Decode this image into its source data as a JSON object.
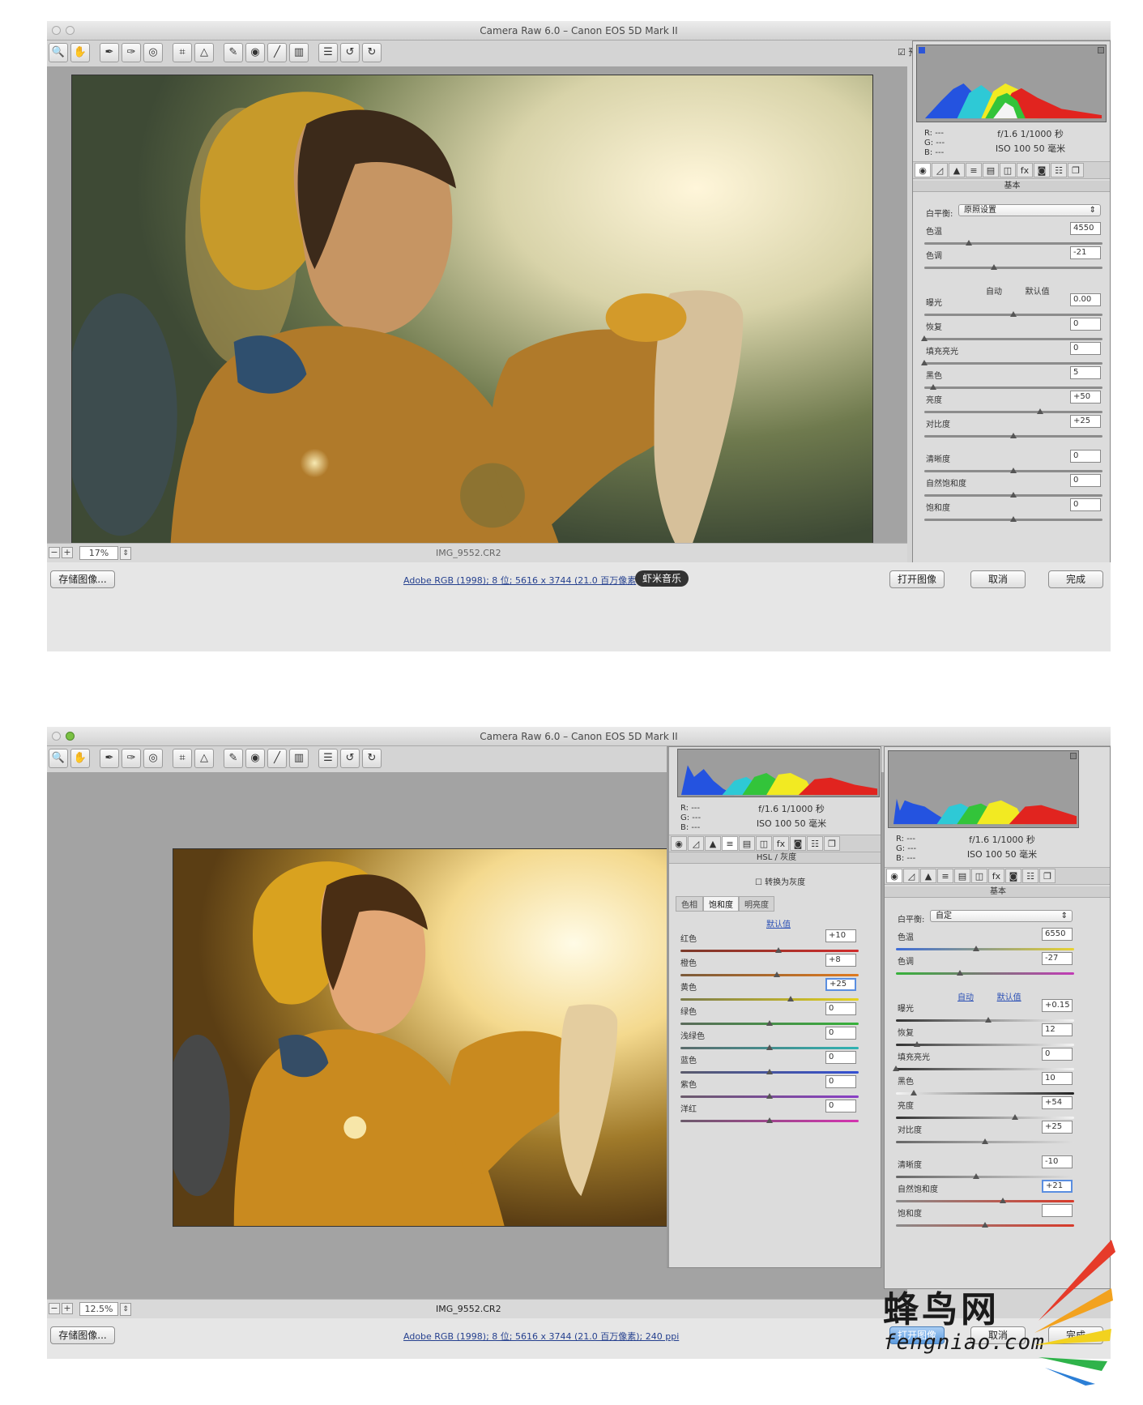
{
  "top": {
    "title": "Camera Raw 6.0 –  Canon EOS 5D Mark II",
    "preview_label": "预览",
    "zoom": "17%",
    "filename": "IMG_9552.CR2",
    "save_label": "存储图像...",
    "info_link": "Adobe RGB (1998); 8 位;   5616 x 3744 (21.0 百万像素",
    "tooltip": "虾米音乐",
    "open_label": "打开图像",
    "cancel_label": "取消",
    "done_label": "完成",
    "rgb": [
      "R:  ---",
      "G:  ---",
      "B:  ---"
    ],
    "exif_line1": "f/1.6    1/1000 秒",
    "exif_line2": "ISO 100    50 毫米",
    "section": "基本",
    "wb_label": "白平衡:",
    "wb_value": "原照设置",
    "auto_label": "自动",
    "default_label": "默认值",
    "sliders": [
      {
        "label": "色温",
        "value": "4550",
        "pos": 0.25
      },
      {
        "label": "色调",
        "value": "-21",
        "pos": 0.39
      },
      {
        "label": "曝光",
        "value": "0.00",
        "pos": 0.5
      },
      {
        "label": "恢复",
        "value": "0",
        "pos": 0.0
      },
      {
        "label": "填充亮光",
        "value": "0",
        "pos": 0.0
      },
      {
        "label": "黑色",
        "value": "5",
        "pos": 0.05
      },
      {
        "label": "亮度",
        "value": "+50",
        "pos": 0.65
      },
      {
        "label": "对比度",
        "value": "+25",
        "pos": 0.5
      },
      {
        "label": "清晰度",
        "value": "0",
        "pos": 0.5
      },
      {
        "label": "自然饱和度",
        "value": "0",
        "pos": 0.5
      },
      {
        "label": "饱和度",
        "value": "0",
        "pos": 0.5
      }
    ]
  },
  "bottom": {
    "title": "Camera Raw 6.0 –  Canon EOS 5D Mark II",
    "zoom": "12.5%",
    "filename": "IMG_9552.CR2",
    "save_label": "存储图像...",
    "info_link": "Adobe RGB (1998); 8 位;   5616 x 3744 (21.0 百万像素); 240 ppi",
    "open_label": "打开图像",
    "cancel_label": "取消",
    "done_label": "完成",
    "rgb": [
      "R:  ---",
      "G:  ---",
      "B:  ---"
    ],
    "exif_line1": "f/1.6    1/1000 秒",
    "exif_line2": "ISO 100    50 毫米",
    "hsl": {
      "section": "HSL / 灰度",
      "convert_label": "转换为灰度",
      "subtabs": [
        "色相",
        "饱和度",
        "明亮度"
      ],
      "default_label": "默认值",
      "sliders": [
        {
          "label": "红色",
          "value": "+10",
          "pos": 0.55,
          "c1": "#7a3a2a",
          "c2": "#d12b2b"
        },
        {
          "label": "橙色",
          "value": "+8",
          "pos": 0.54,
          "c1": "#7a5a3a",
          "c2": "#e07a1f"
        },
        {
          "label": "黄色",
          "value": "+25",
          "pos": 0.62,
          "c1": "#7a7a4a",
          "c2": "#e6d21e"
        },
        {
          "label": "绿色",
          "value": "0",
          "pos": 0.5,
          "c1": "#5a6a5a",
          "c2": "#36b23a"
        },
        {
          "label": "浅绿色",
          "value": "0",
          "pos": 0.5,
          "c1": "#5a6a6a",
          "c2": "#2fb3b3"
        },
        {
          "label": "蓝色",
          "value": "0",
          "pos": 0.5,
          "c1": "#5a5a6a",
          "c2": "#3350d4"
        },
        {
          "label": "紫色",
          "value": "0",
          "pos": 0.5,
          "c1": "#6a5a6a",
          "c2": "#8a3fc6"
        },
        {
          "label": "洋红",
          "value": "0",
          "pos": 0.5,
          "c1": "#6a5a6a",
          "c2": "#d433b0"
        }
      ]
    },
    "basic": {
      "section": "基本",
      "wb_label": "白平衡:",
      "wb_value": "自定",
      "auto_label": "自动",
      "default_label": "默认值",
      "sliders": [
        {
          "label": "色温",
          "value": "6550",
          "pos": 0.45,
          "c1": "#3c6bd8",
          "c2": "#e7d232"
        },
        {
          "label": "色调",
          "value": "-27",
          "pos": 0.36,
          "c1": "#36b23a",
          "c2": "#c23bb6"
        },
        {
          "label": "曝光",
          "value": "+0.15",
          "pos": 0.52,
          "c1": "#333333",
          "c2": "#f4f4f4"
        },
        {
          "label": "恢复",
          "value": "12",
          "pos": 0.12,
          "c1": "#333333",
          "c2": "#f4f4f4"
        },
        {
          "label": "填充亮光",
          "value": "0",
          "pos": 0.0,
          "c1": "#333333",
          "c2": "#f4f4f4"
        },
        {
          "label": "黑色",
          "value": "10",
          "pos": 0.1,
          "c1": "#f4f4f4",
          "c2": "#222222"
        },
        {
          "label": "亮度",
          "value": "+54",
          "pos": 0.67,
          "c1": "#333333",
          "c2": "#f4f4f4"
        },
        {
          "label": "对比度",
          "value": "+25",
          "pos": 0.5,
          "c1": "#666666",
          "c2": "#dddddd"
        },
        {
          "label": "清晰度",
          "value": "-10",
          "pos": 0.45,
          "c1": "#666666",
          "c2": "#dddddd"
        },
        {
          "label": "自然饱和度",
          "value": "+21",
          "pos": 0.6,
          "c1": "#8a8a8a",
          "c2": "#d83a2a"
        },
        {
          "label": "饱和度",
          "value": "",
          "pos": 0.5,
          "c1": "#8a8a8a",
          "c2": "#d83a2a"
        }
      ]
    }
  },
  "watermark": {
    "cn": "蜂鸟网",
    "en": "fengniao.com"
  },
  "colors": {
    "canvas": "#a3a3a3",
    "panel": "#dcdcdc",
    "accent": "#5a8ee0"
  }
}
